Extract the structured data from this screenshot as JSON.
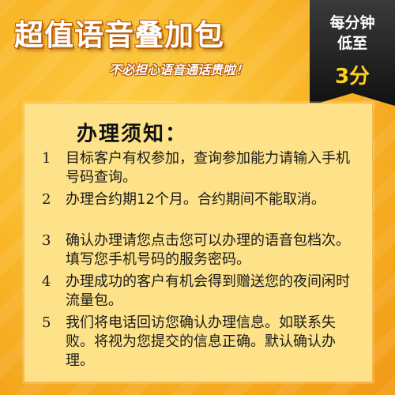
{
  "banner": {
    "title": "超值语音叠加包",
    "subtitle": "不必担心语音通话贵啦！"
  },
  "badge": {
    "line1": "每分钟",
    "line2": "低至",
    "rate": "3分"
  },
  "notice": {
    "title": "办理须知：",
    "rules": [
      {
        "num": "1",
        "text": "目标客户有权参加，查询参加能力请输入手机号码查询。"
      },
      {
        "num": "2",
        "text": "办理合约期12个月。合约期间不能取消。"
      },
      {
        "num": "3",
        "text": "确认办理请您点击您可以办理的语音包档次。填写您手机号码的服务密码。"
      },
      {
        "num": "4",
        "text": "办理成功的客户有机会得到赠送您的夜间闲时流量包。"
      },
      {
        "num": "5",
        "text": "我们将电话回访您确认办理信息。如联系失败。将视为您提交的信息正确。默认确认办理。"
      }
    ]
  },
  "colors": {
    "background": "#f6a21a",
    "panel": "#fde289",
    "badge": "#1a1a1a",
    "badge_rate": "#ffd21a",
    "headline_outline": "#c15a00"
  }
}
